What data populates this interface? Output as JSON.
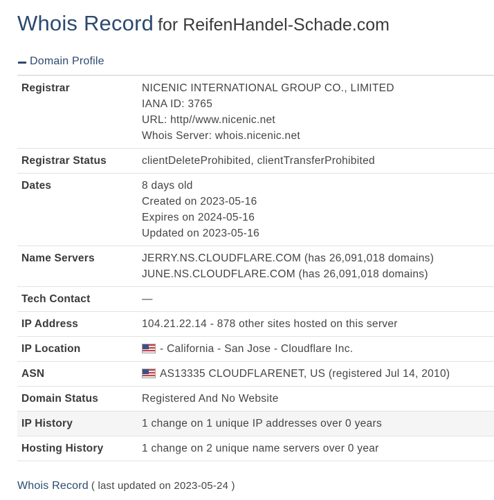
{
  "header": {
    "title": "Whois Record",
    "subtitle": "for ReifenHandel-Schade.com"
  },
  "section": {
    "title": "Domain Profile",
    "icon": "minus-icon"
  },
  "rows": {
    "registrar": {
      "label": "Registrar",
      "lines": [
        "NICENIC INTERNATIONAL GROUP CO., LIMITED",
        "IANA ID: 3765",
        "URL: http//www.nicenic.net",
        "Whois Server: whois.nicenic.net"
      ]
    },
    "registrar_status": {
      "label": "Registrar Status",
      "value": "clientDeleteProhibited, clientTransferProhibited"
    },
    "dates": {
      "label": "Dates",
      "lines": [
        "8 days old",
        "Created on 2023-05-16",
        "Expires on 2024-05-16",
        "Updated on 2023-05-16"
      ]
    },
    "name_servers": {
      "label": "Name Servers",
      "lines": [
        "JERRY.NS.CLOUDFLARE.COM (has 26,091,018 domains)",
        "JUNE.NS.CLOUDFLARE.COM (has 26,091,018 domains)"
      ]
    },
    "tech_contact": {
      "label": "Tech Contact",
      "value": "—"
    },
    "ip_address": {
      "label": "IP Address",
      "value": "104.21.22.14 - 878 other sites hosted on this server"
    },
    "ip_location": {
      "label": "IP Location",
      "value": "- California - San Jose - Cloudflare Inc.",
      "flag": "us-flag-icon"
    },
    "asn": {
      "label": "ASN",
      "value": "AS13335 CLOUDFLARENET, US (registered Jul 14, 2010)",
      "flag": "us-flag-icon"
    },
    "domain_status": {
      "label": "Domain Status",
      "value": "Registered And No Website"
    },
    "ip_history": {
      "label": "IP History",
      "value": "1 change on 1 unique IP addresses over 0 years"
    },
    "hosting_history": {
      "label": "Hosting History",
      "value": "1 change on 2 unique name servers over 0 year"
    }
  },
  "footer": {
    "link": "Whois Record",
    "note": "( last updated on 2023-05-24 )"
  },
  "colors": {
    "heading": "#2c4a6e",
    "text": "#444444",
    "row_alt": "#f5f5f5",
    "divider": "#e2e2e2"
  }
}
